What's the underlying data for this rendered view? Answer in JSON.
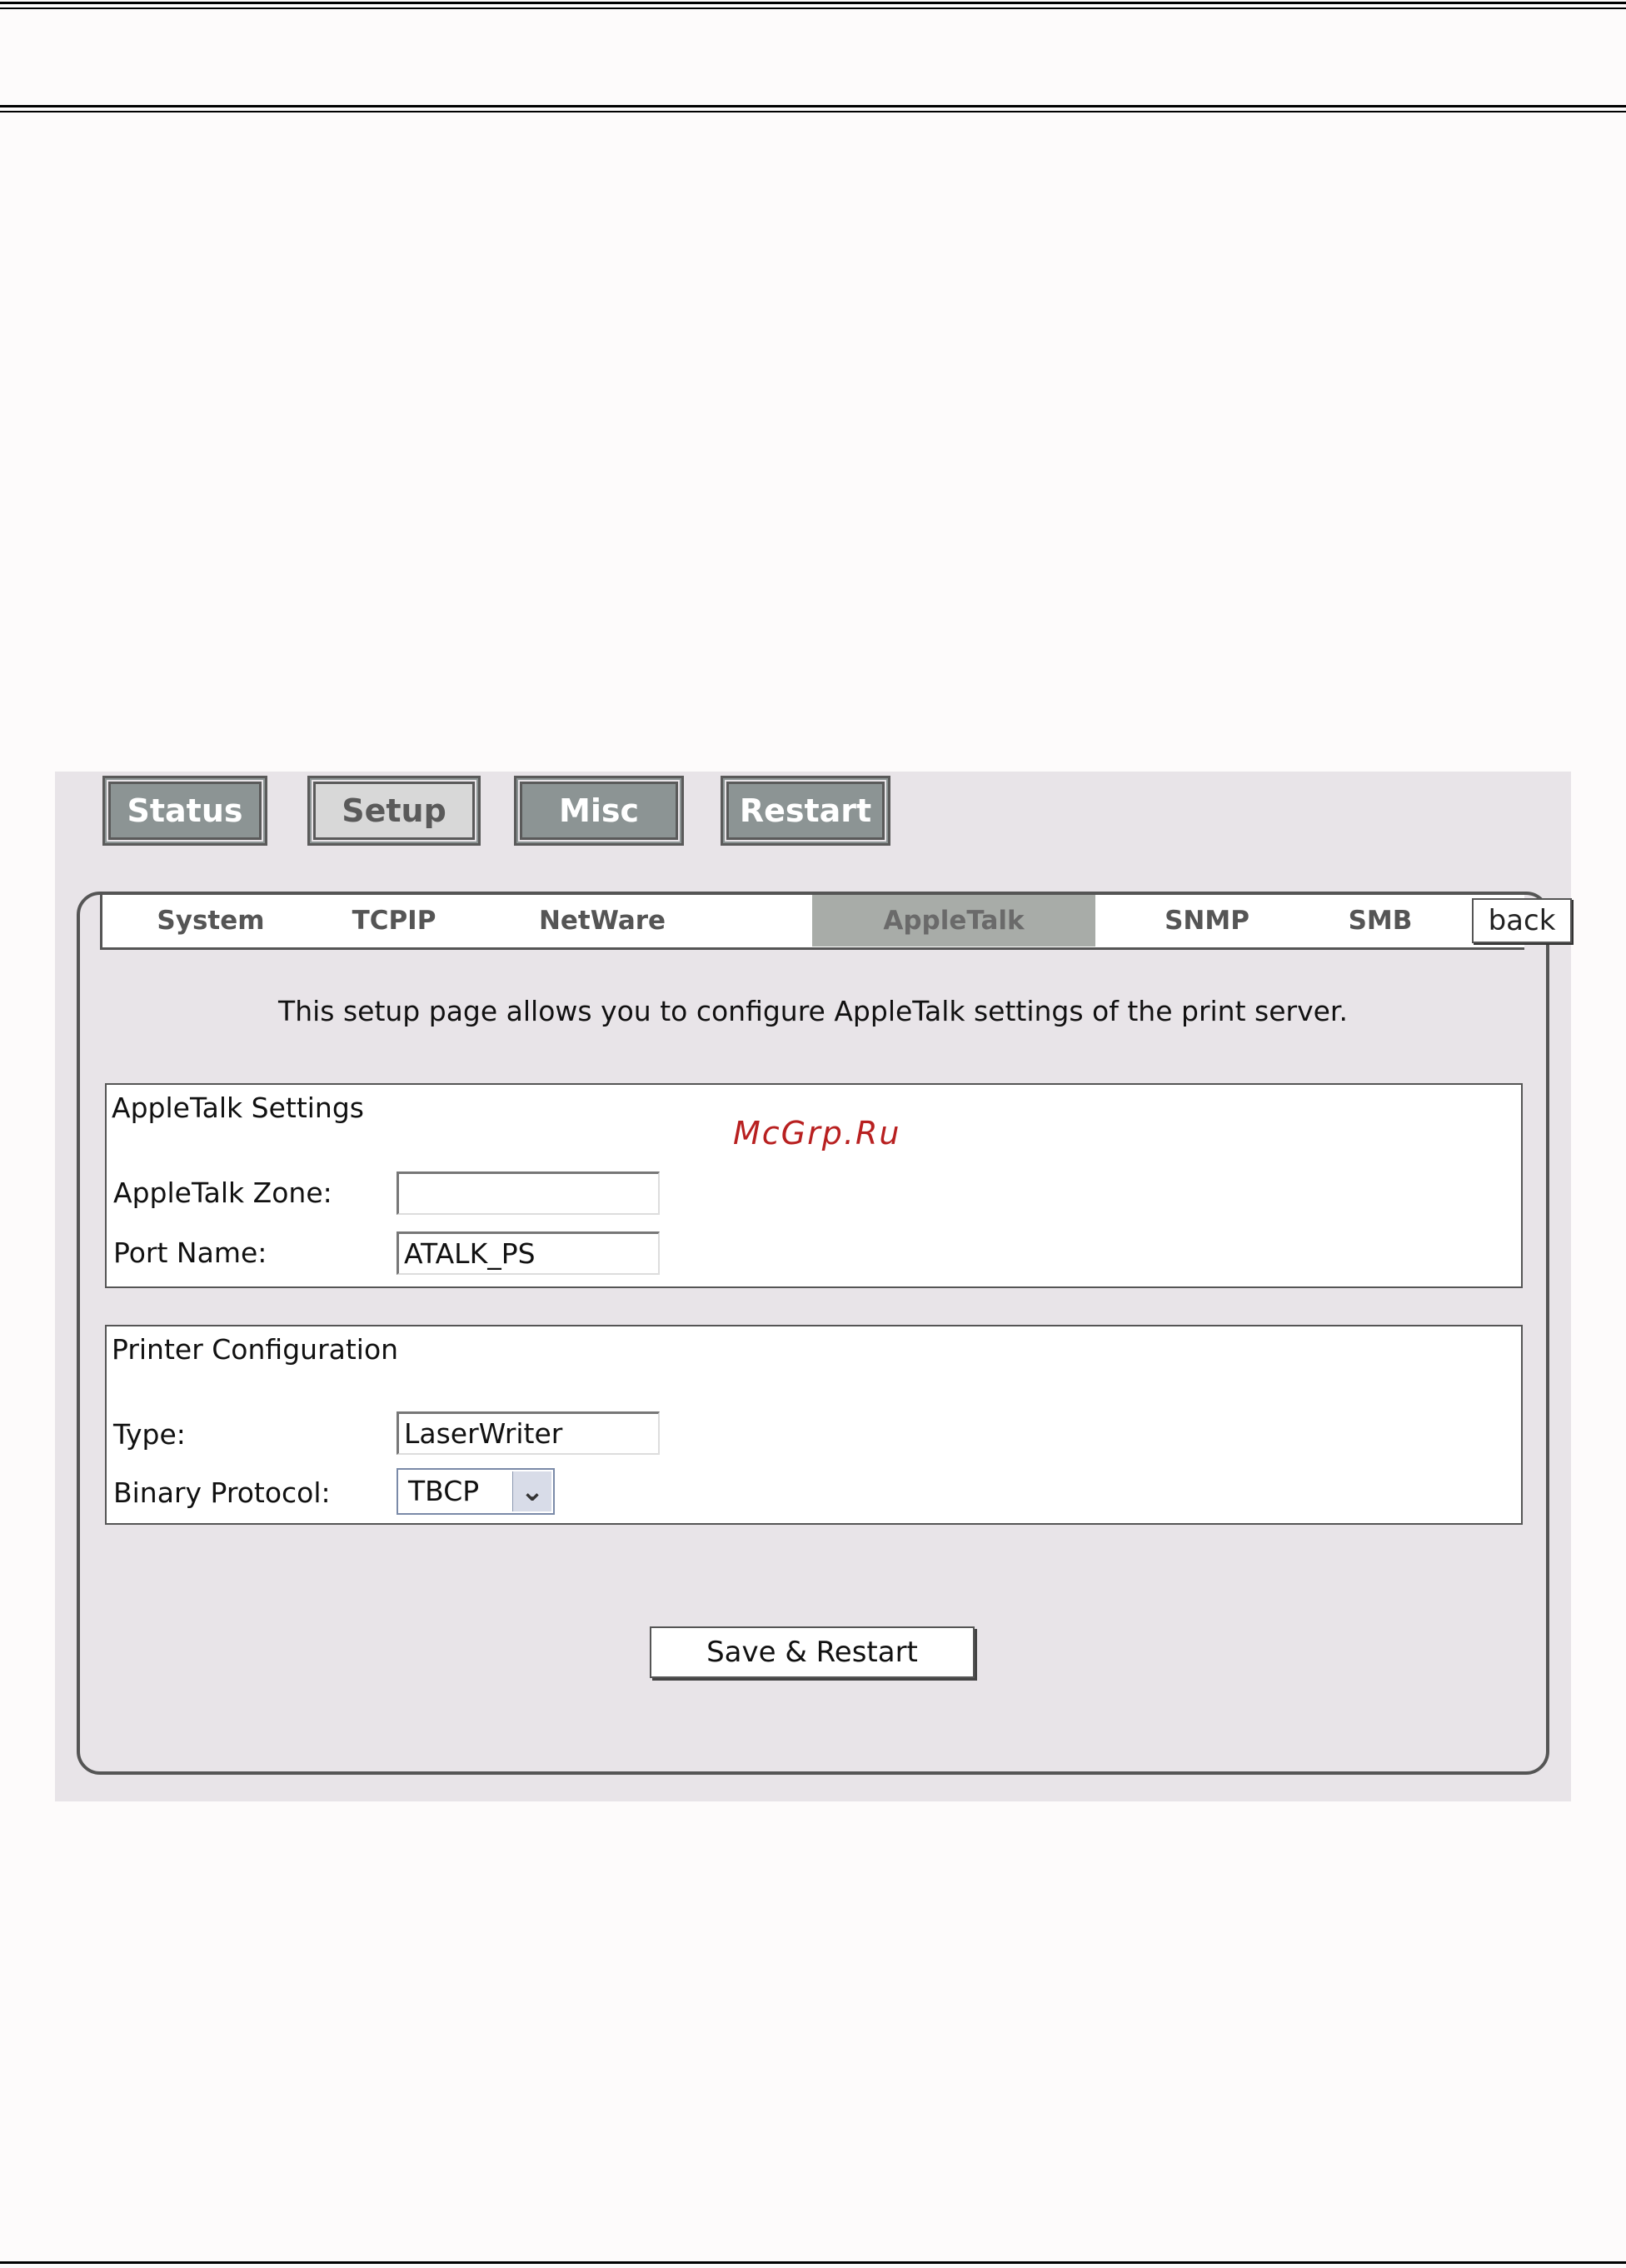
{
  "top_buttons": [
    {
      "label": "Status",
      "active": false
    },
    {
      "label": "Setup",
      "active": true
    },
    {
      "label": "Misc",
      "active": false
    },
    {
      "label": "Restart",
      "active": false
    }
  ],
  "sub_tabs": [
    {
      "label": "System",
      "active": false
    },
    {
      "label": "TCPIP",
      "active": false
    },
    {
      "label": "NetWare",
      "active": false
    },
    {
      "label": "AppleTalk",
      "active": true
    },
    {
      "label": "SNMP",
      "active": false
    },
    {
      "label": "SMB",
      "active": false
    }
  ],
  "back_label": "back",
  "intro": "This setup page allows you to configure AppleTalk settings of the print server.",
  "appletalk_settings": {
    "legend": "AppleTalk Settings",
    "zone_label": "AppleTalk Zone:",
    "zone_value": "",
    "port_label": "Port Name:",
    "port_value": "ATALK_PS"
  },
  "printer_config": {
    "legend": "Printer Configuration",
    "type_label": "Type:",
    "type_value": "LaserWriter",
    "protocol_label": "Binary Protocol:",
    "protocol_value": "TBCP"
  },
  "save_label": "Save & Restart",
  "watermark": "McGrp.Ru"
}
